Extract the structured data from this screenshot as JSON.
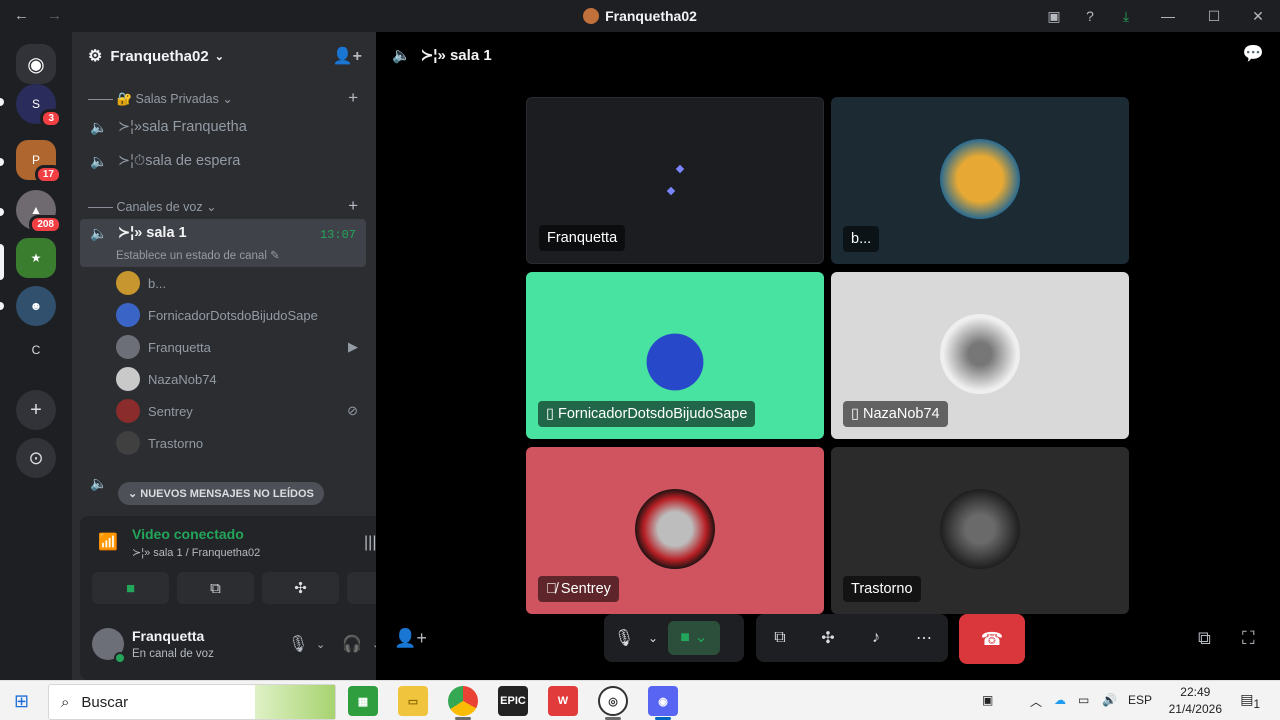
{
  "titlebar": {
    "title": "Franquetha02",
    "back": "←",
    "forward": "→"
  },
  "guilds": {
    "badges": [
      "3",
      "17",
      "208"
    ],
    "letter": "C",
    "add": "+",
    "discover": "⊙"
  },
  "server": {
    "name": "Franquetha02",
    "categories": [
      {
        "label": "—— 🔐 Salas Privadas ⌄"
      },
      {
        "label": "—— Canales de voz ⌄"
      }
    ],
    "private_channels": [
      "≻¦»sala Franquetha",
      "≻¦⏱sala de espera"
    ],
    "active_channel": {
      "name": "≻¦» sala 1",
      "time": "13:07",
      "status": "Establece un estado de canal ✎"
    },
    "users": [
      "b...",
      "FornicadorDotsdoBijudoSape",
      "Franquetta",
      "NazaNob74",
      "Sentrey",
      "Trastorno"
    ],
    "new_messages": "⌄  NUEVOS MENSAJES NO LEÍDOS"
  },
  "voice_panel": {
    "title": "Video conectado",
    "subtitle": "≻¦» sala 1 / Franquetha02"
  },
  "user_panel": {
    "name": "Franquetta",
    "status": "En canal de voz"
  },
  "stage": {
    "channel": "≻¦» sala 1",
    "tiles": [
      {
        "label": "Franquetta",
        "bg": "#1c1d21"
      },
      {
        "label": "b...",
        "bg": "#1b2a33"
      },
      {
        "label": "FornicadorDotsdoBijudoSape",
        "bg": "#49e3a1",
        "mobile": "▯"
      },
      {
        "label": "NazaNob74",
        "bg": "#d9d9d9",
        "mobile": "▯"
      },
      {
        "label": "Sentrey",
        "bg": "#d0545f",
        "muted": "🎙̸"
      },
      {
        "label": "Trastorno",
        "bg": "#2b2b2b"
      }
    ]
  },
  "taskbar": {
    "search": "Buscar",
    "lang": "ESP",
    "time": "22:49",
    "date": "21/4/2026",
    "notif_count": "1",
    "epic_label": "EPIC"
  },
  "colors": {
    "green": "#23a55a",
    "red": "#da373c",
    "blurple": "#5865f2"
  }
}
